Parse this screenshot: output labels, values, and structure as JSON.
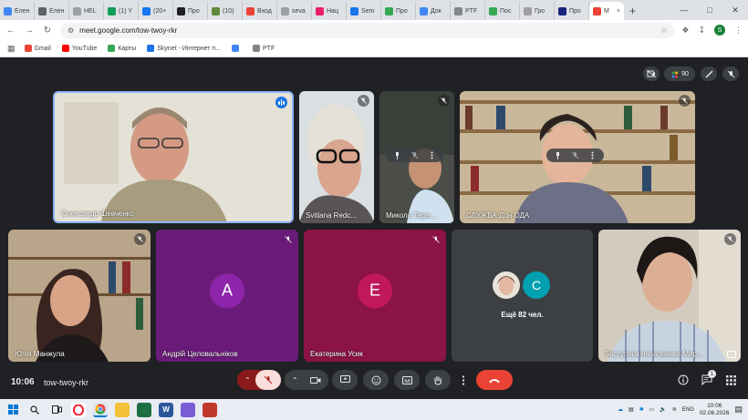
{
  "browser": {
    "tabs": [
      {
        "label": "Елен",
        "color": "#4285f4"
      },
      {
        "label": "Елен",
        "color": "#5f6368"
      },
      {
        "label": "HEL",
        "color": "#9aa0a6"
      },
      {
        "label": "(1) Y",
        "color": "#0f9d58"
      },
      {
        "label": "(20+",
        "color": "#1877f2"
      },
      {
        "label": "Про",
        "color": "#202124"
      },
      {
        "label": "(10)",
        "color": "#5d8a3a"
      },
      {
        "label": "Вход",
        "color": "#ea4335"
      },
      {
        "label": "seva",
        "color": "#9aa0a6"
      },
      {
        "label": "Нац",
        "color": "#e91e63"
      },
      {
        "label": "Sem",
        "color": "#1a73e8"
      },
      {
        "label": "Про",
        "color": "#34a853"
      },
      {
        "label": "Док",
        "color": "#4285f4"
      },
      {
        "label": "PTF",
        "color": "#80868b"
      },
      {
        "label": "Пос",
        "color": "#34a853"
      },
      {
        "label": "Гро",
        "color": "#9e9e9e"
      },
      {
        "label": "Про",
        "color": "#1a237e"
      },
      {
        "label": "M",
        "color": "#ea4335",
        "active": true
      }
    ],
    "new_tab": "+",
    "url": "meet.google.com/tow-twoy-rkr",
    "profile_initial": "S",
    "bookmarks": [
      {
        "label": "Gmail",
        "color": "#ea4335"
      },
      {
        "label": "YouTube",
        "color": "#ff0000"
      },
      {
        "label": "Карты",
        "color": "#34a853"
      },
      {
        "label": "Skynet - Интернет п...",
        "color": "#1a73e8"
      },
      {
        "label": "",
        "color": "#4285f4"
      },
      {
        "label": "PTF",
        "color": "#80868b"
      }
    ]
  },
  "meet": {
    "top_controls": {
      "participants_count": "90"
    },
    "participants": [
      {
        "name": "Олександр Шевченко",
        "speaking": true
      },
      {
        "name": "Svitlana Redc...",
        "muted": true
      },
      {
        "name": "Микола Тере...",
        "muted": true
      },
      {
        "name": "СЛУЖБА Дон ОДА",
        "muted": true
      },
      {
        "name": "Юлія Манжула",
        "muted": true
      },
      {
        "name": "Андрій Целовальніков",
        "initial": "А",
        "color": "#7b1fa2",
        "muted": true
      },
      {
        "name": "Екатерина Усик",
        "initial": "Е",
        "color": "#c2185b",
        "muted": true
      },
      {
        "name": "Заступник начальника Мир...",
        "muted": true
      }
    ],
    "others": {
      "label": "Ещё 82 чел.",
      "initial": "C",
      "color": "#00a0b0"
    },
    "meeting_time": "10:06",
    "meeting_code": "tow-twoy-rkr",
    "chat_badge": "1"
  },
  "taskbar": {
    "lang": "ENG",
    "time": "10:06",
    "date": "02.06.2026"
  }
}
